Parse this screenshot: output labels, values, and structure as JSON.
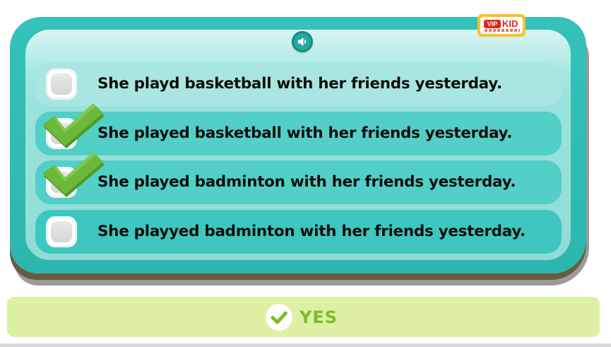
{
  "logo": {
    "vip": "VIP",
    "kid": "KID"
  },
  "question": {
    "audio_icon": "speaker-icon"
  },
  "options": [
    {
      "label": "She playd basketball with her friends yesterday.",
      "checked": false
    },
    {
      "label": "She played basketball with her friends yesterday.",
      "checked": true
    },
    {
      "label": "She played badminton with her friends yesterday.",
      "checked": true
    },
    {
      "label": "She playyed badminton with her friends yesterday.",
      "checked": false
    }
  ],
  "feedback": {
    "label": "YES",
    "icon": "check-circle-icon"
  },
  "colors": {
    "card": "#2db6ae",
    "panel": "#9be3de",
    "check": "#6cb83a",
    "feedback_bg": "#ddf0a3",
    "feedback_text": "#7cbc2a",
    "brand": "#e2231a"
  }
}
